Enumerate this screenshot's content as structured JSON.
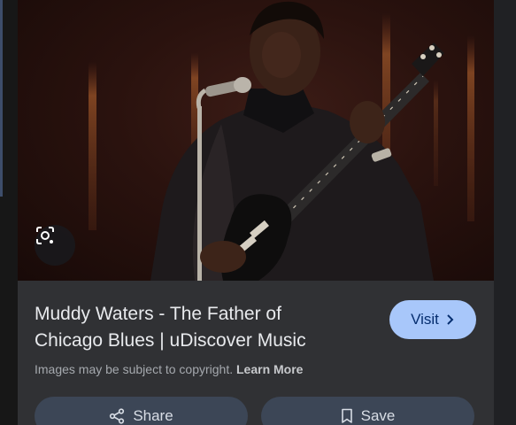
{
  "result": {
    "title": "Muddy Waters - The Father of Chicago Blues | uDiscover Music",
    "copyright_text": "Images may be subject to copyright.",
    "learn_more_label": "Learn More"
  },
  "actions": {
    "visit_label": "Visit",
    "share_label": "Share",
    "save_label": "Save"
  },
  "icons": {
    "lens": "google-lens-icon",
    "visit": "chevron-right-icon",
    "share": "share-icon",
    "save": "bookmark-icon"
  },
  "colors": {
    "visit_button": "#a8c7fa",
    "pill_button": "#3c4656",
    "panel": "#303134"
  }
}
